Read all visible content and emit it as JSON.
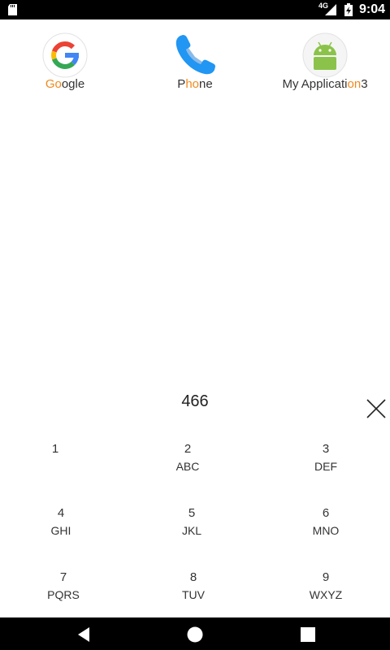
{
  "status_bar": {
    "network": "4G",
    "time": "9:04"
  },
  "apps": [
    {
      "label_parts": [
        "",
        "Go",
        "ogle",
        ""
      ],
      "label": "Google"
    },
    {
      "label_parts": [
        "P",
        "ho",
        "ne",
        ""
      ],
      "label": "Phone"
    },
    {
      "label_parts": [
        "My Applicati",
        "on",
        "3",
        ""
      ],
      "label": "My Application3"
    }
  ],
  "dialer": {
    "input_value": "466",
    "keys": [
      {
        "digit": "1",
        "letters": ""
      },
      {
        "digit": "2",
        "letters": "ABC"
      },
      {
        "digit": "3",
        "letters": "DEF"
      },
      {
        "digit": "4",
        "letters": "GHI"
      },
      {
        "digit": "5",
        "letters": "JKL"
      },
      {
        "digit": "6",
        "letters": "MNO"
      },
      {
        "digit": "7",
        "letters": "PQRS"
      },
      {
        "digit": "8",
        "letters": "TUV"
      },
      {
        "digit": "9",
        "letters": "WXYZ"
      }
    ]
  },
  "icons": {
    "clear": "close-icon",
    "back": "back-icon",
    "home": "home-icon",
    "recents": "recents-icon"
  },
  "colors": {
    "highlight": "#f08a1c",
    "phone_blue": "#2196f3",
    "android_green": "#8bc34a"
  }
}
